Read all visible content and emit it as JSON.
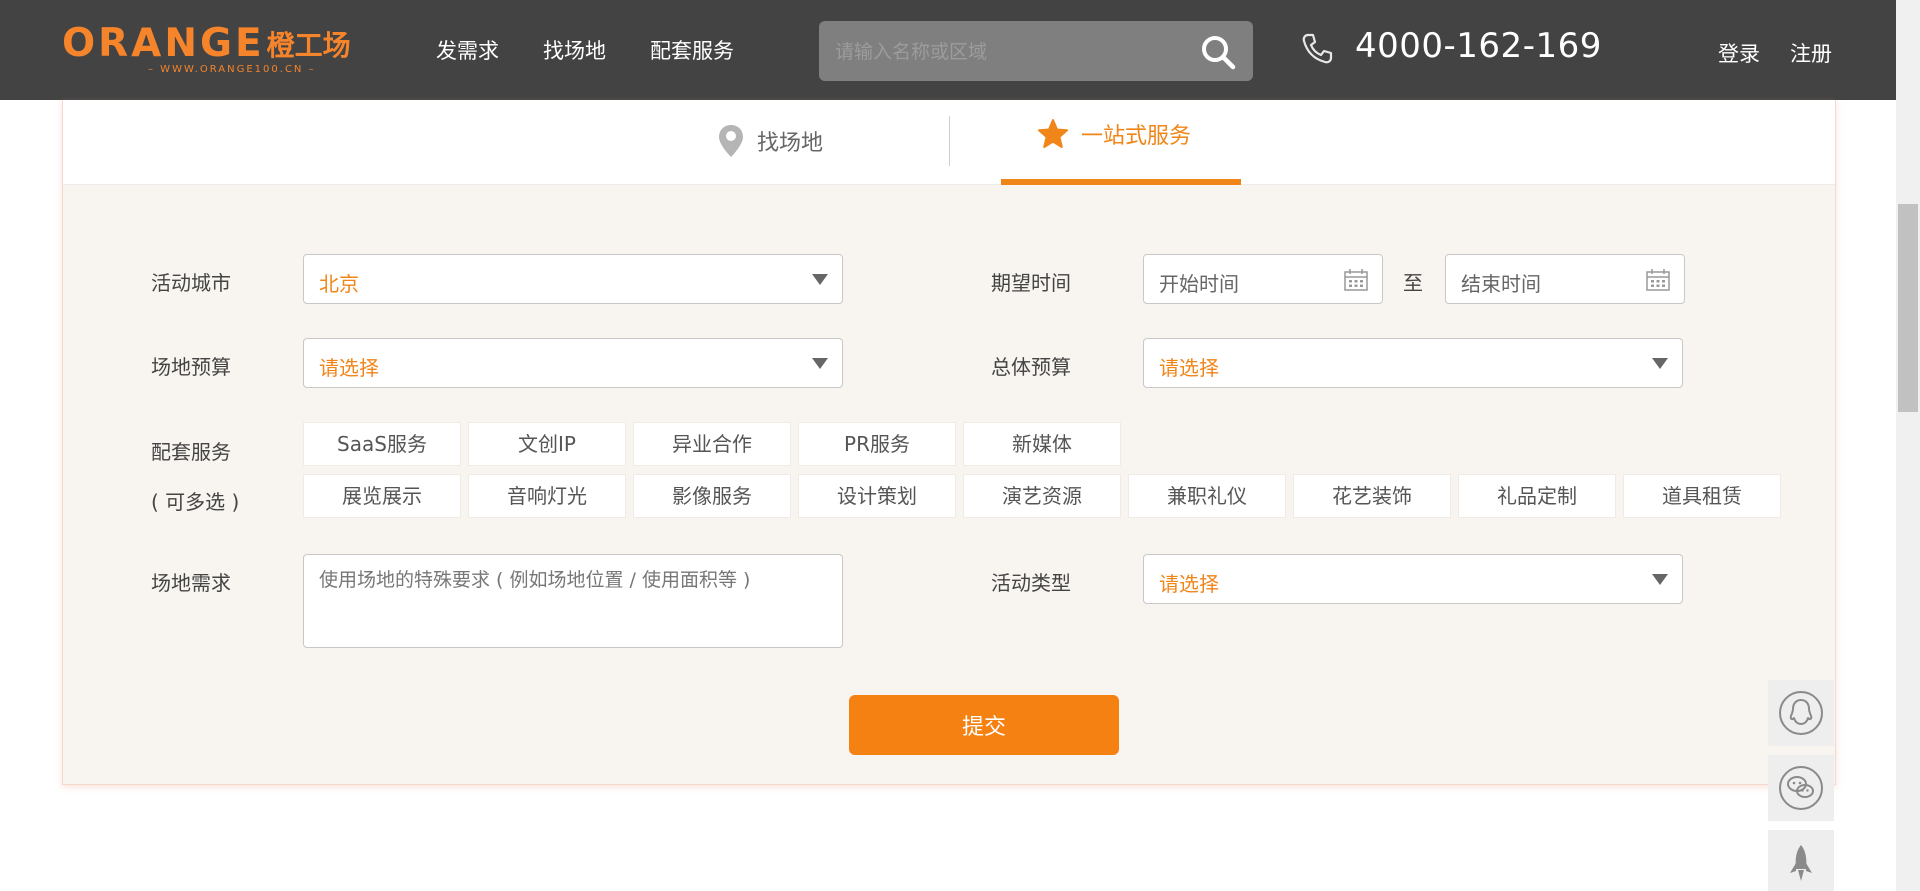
{
  "header": {
    "logo_en": "ORANGE",
    "logo_cn": "橙工场",
    "logo_sub": "– WWW.ORANGE100.CN –",
    "nav": [
      "发需求",
      "找场地",
      "配套服务"
    ],
    "search_placeholder": "请输入名称或区域",
    "phone": "4000-162-169",
    "login": "登录",
    "register": "注册"
  },
  "tabs": {
    "venue": "找场地",
    "service": "一站式服务",
    "active": "service"
  },
  "form": {
    "city_label": "活动城市",
    "city_value": "北京",
    "time_label": "期望时间",
    "start_placeholder": "开始时间",
    "to_label": "至",
    "end_placeholder": "结束时间",
    "venue_budget_label": "场地预算",
    "venue_budget_value": "请选择",
    "total_budget_label": "总体预算",
    "total_budget_value": "请选择",
    "services_label": "配套服务",
    "services_hint": "( 可多选 )",
    "services_row1": [
      "SaaS服务",
      "文创IP",
      "异业合作",
      "PR服务",
      "新媒体"
    ],
    "services_row2": [
      "展览展示",
      "音响灯光",
      "影像服务",
      "设计策划",
      "演艺资源",
      "兼职礼仪",
      "花艺装饰",
      "礼品定制",
      "道具租赁"
    ],
    "venue_req_label": "场地需求",
    "venue_req_placeholder": "使用场地的特殊要求 ( 例如场地位置 / 使用面积等 )",
    "event_type_label": "活动类型",
    "event_type_value": "请选择",
    "submit": "提交"
  },
  "colors": {
    "header_bg": "#434343",
    "accent": "#f08519",
    "panel_bg": "#f8f4ef"
  },
  "float_buttons": [
    "qq-icon",
    "wechat-icon",
    "rocket-icon"
  ]
}
